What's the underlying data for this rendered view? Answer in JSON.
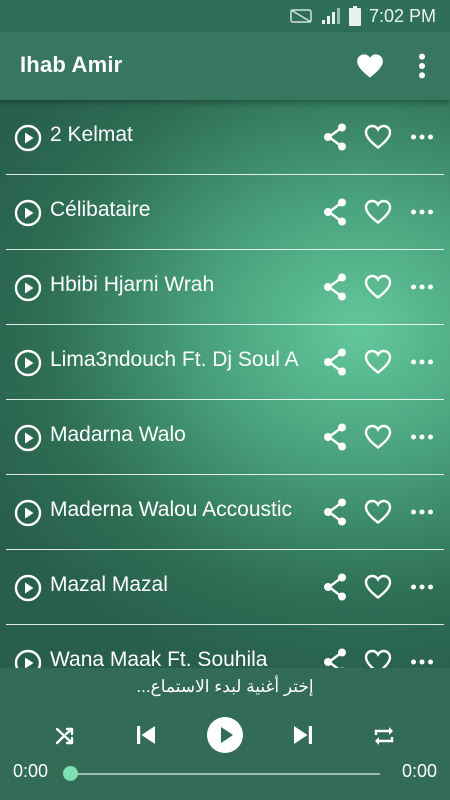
{
  "status_bar": {
    "time": "7:02 PM"
  },
  "app_bar": {
    "title": "Ihab Amir",
    "favorites_icon": "heart-filled-icon",
    "menu_icon": "overflow-menu-icon"
  },
  "songs": [
    {
      "title": "2 Kelmat"
    },
    {
      "title": "Célibataire"
    },
    {
      "title": "Hbibi Hjarni Wrah"
    },
    {
      "title": "Lima3ndouch Ft. Dj Soul A"
    },
    {
      "title": "Madarna Walo"
    },
    {
      "title": "Maderna Walou Accoustic"
    },
    {
      "title": "Mazal Mazal"
    },
    {
      "title": "Wana Maak Ft. Souhila"
    }
  ],
  "player": {
    "now_playing_text": "إختر أغنية لبدء الاستماع...",
    "current_time": "0:00",
    "total_time": "0:00",
    "progress": 0
  },
  "colors": {
    "app_bar": "#37775f",
    "status_bar": "#2f6f57",
    "player_bar": "#326b56",
    "seek_thumb": "#7de0b0"
  }
}
